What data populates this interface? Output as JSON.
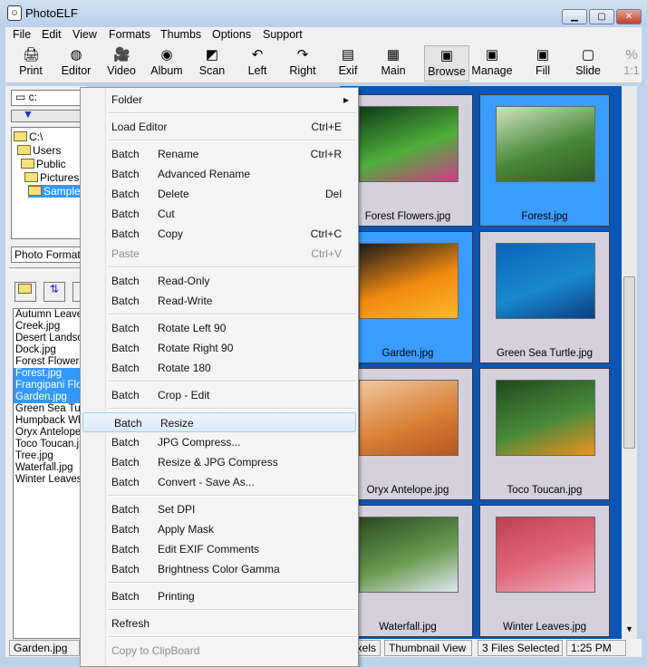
{
  "window": {
    "title": "PhotoELF",
    "min": "▁",
    "max": "▢",
    "close": "✕"
  },
  "menubar": [
    "File",
    "Edit",
    "View",
    "Formats",
    "Thumbs",
    "Options",
    "Support"
  ],
  "toolbar": [
    {
      "label": "Print",
      "icon": "🖨"
    },
    {
      "label": "Editor",
      "icon": "◍"
    },
    {
      "label": "Video",
      "icon": "🎥"
    },
    {
      "label": "Album",
      "icon": "◉"
    },
    {
      "label": "Scan",
      "icon": "◩"
    },
    {
      "label": "Left",
      "icon": "↶"
    },
    {
      "label": "Right",
      "icon": "↷"
    },
    {
      "label": "Exif",
      "icon": "▤"
    },
    {
      "label": "Main",
      "icon": "▦"
    },
    {
      "label": "Browse",
      "icon": "▣",
      "active": true
    },
    {
      "label": "Manage",
      "icon": "▣"
    },
    {
      "label": "Fill",
      "icon": "▣"
    },
    {
      "label": "Slide",
      "icon": "▢"
    },
    {
      "label": "1:1",
      "icon": "%"
    }
  ],
  "left": {
    "drive": "c:",
    "tree": [
      "C:\\",
      "Users",
      "Public",
      "Pictures",
      "Sample Pictures"
    ],
    "formats": "Photo Formats",
    "files": [
      {
        "n": "Autumn Leaves.jpg"
      },
      {
        "n": "Creek.jpg"
      },
      {
        "n": "Desert Landscape.jpg"
      },
      {
        "n": "Dock.jpg"
      },
      {
        "n": "Forest Flowers.jpg"
      },
      {
        "n": "Forest.jpg",
        "s": true
      },
      {
        "n": "Frangipani Flowers.jpg",
        "s": true
      },
      {
        "n": "Garden.jpg",
        "s": true
      },
      {
        "n": "Green Sea Turtle.jpg"
      },
      {
        "n": "Humpback Whale.jpg"
      },
      {
        "n": "Oryx Antelope.jpg"
      },
      {
        "n": "Toco Toucan.jpg"
      },
      {
        "n": "Tree.jpg"
      },
      {
        "n": "Waterfall.jpg"
      },
      {
        "n": "Winter Leaves.jpg"
      }
    ]
  },
  "thumbs": [
    {
      "name": "Forest Flowers.jpg",
      "selected": false,
      "colors": [
        "#0f3d1a",
        "#4fae3a",
        "#d03a8a"
      ]
    },
    {
      "name": "Forest.jpg",
      "selected": true,
      "colors": [
        "#cfe3c2",
        "#4a8a3a",
        "#2d5a22"
      ]
    },
    {
      "name": "Garden.jpg",
      "selected": true,
      "colors": [
        "#1a1a1a",
        "#f08a10",
        "#ffb82a"
      ]
    },
    {
      "name": "Green Sea Turtle.jpg",
      "selected": false,
      "colors": [
        "#0a62b8",
        "#1a8ad0",
        "#0a3d80"
      ]
    },
    {
      "name": "Oryx Antelope.jpg",
      "selected": false,
      "colors": [
        "#f0c8a0",
        "#d9823a",
        "#b8551e"
      ]
    },
    {
      "name": "Toco Toucan.jpg",
      "selected": false,
      "colors": [
        "#1e4a1c",
        "#4a8a3a",
        "#f09020"
      ]
    },
    {
      "name": "Waterfall.jpg",
      "selected": false,
      "colors": [
        "#2a4a20",
        "#6a9a50",
        "#e0e8f0"
      ]
    },
    {
      "name": "Winter Leaves.jpg",
      "selected": false,
      "colors": [
        "#c04050",
        "#e06a7a",
        "#f0b0c0"
      ]
    }
  ],
  "context_menu": [
    {
      "a": "Folder",
      "sub": true
    },
    {
      "sep": true
    },
    {
      "a": "Load Editor",
      "k": "Ctrl+E"
    },
    {
      "sep": true
    },
    {
      "a": "Batch",
      "b": "Rename",
      "k": "Ctrl+R"
    },
    {
      "a": "Batch",
      "b": "Advanced Rename"
    },
    {
      "a": "Batch",
      "b": "Delete",
      "k": "Del"
    },
    {
      "a": "Batch",
      "b": "Cut"
    },
    {
      "a": "Batch",
      "b": "Copy",
      "k": "Ctrl+C"
    },
    {
      "a": "Paste",
      "k": "Ctrl+V",
      "dis": true
    },
    {
      "sep": true
    },
    {
      "a": "Batch",
      "b": "Read-Only"
    },
    {
      "a": "Batch",
      "b": "Read-Write"
    },
    {
      "sep": true
    },
    {
      "a": "Batch",
      "b": "Rotate Left 90"
    },
    {
      "a": "Batch",
      "b": "Rotate Right 90"
    },
    {
      "a": "Batch",
      "b": "Rotate 180"
    },
    {
      "sep": true
    },
    {
      "a": "Batch",
      "b": "Crop - Edit"
    },
    {
      "sep": true
    },
    {
      "a": "Batch",
      "b": "Resize",
      "hl": true
    },
    {
      "a": "Batch",
      "b": "JPG Compress..."
    },
    {
      "a": "Batch",
      "b": "Resize & JPG Compress"
    },
    {
      "a": "Batch",
      "b": "Convert - Save As..."
    },
    {
      "sep": true
    },
    {
      "a": "Batch",
      "b": "Set DPI"
    },
    {
      "a": "Batch",
      "b": "Apply Mask"
    },
    {
      "a": "Batch",
      "b": "Edit EXIF Comments"
    },
    {
      "a": "Batch",
      "b": "Brightness Color Gamma"
    },
    {
      "sep": true
    },
    {
      "a": "Batch",
      "b": "Printing"
    },
    {
      "sep": true
    },
    {
      "a": "Refresh"
    },
    {
      "sep": true
    },
    {
      "a": "Copy to ClipBoard",
      "dis": true
    }
  ],
  "status": {
    "file": "Garden.jpg",
    "pixels": "Pixels",
    "view": "Thumbnail View",
    "selected": "3 Files Selected",
    "time": "1:25 PM"
  }
}
